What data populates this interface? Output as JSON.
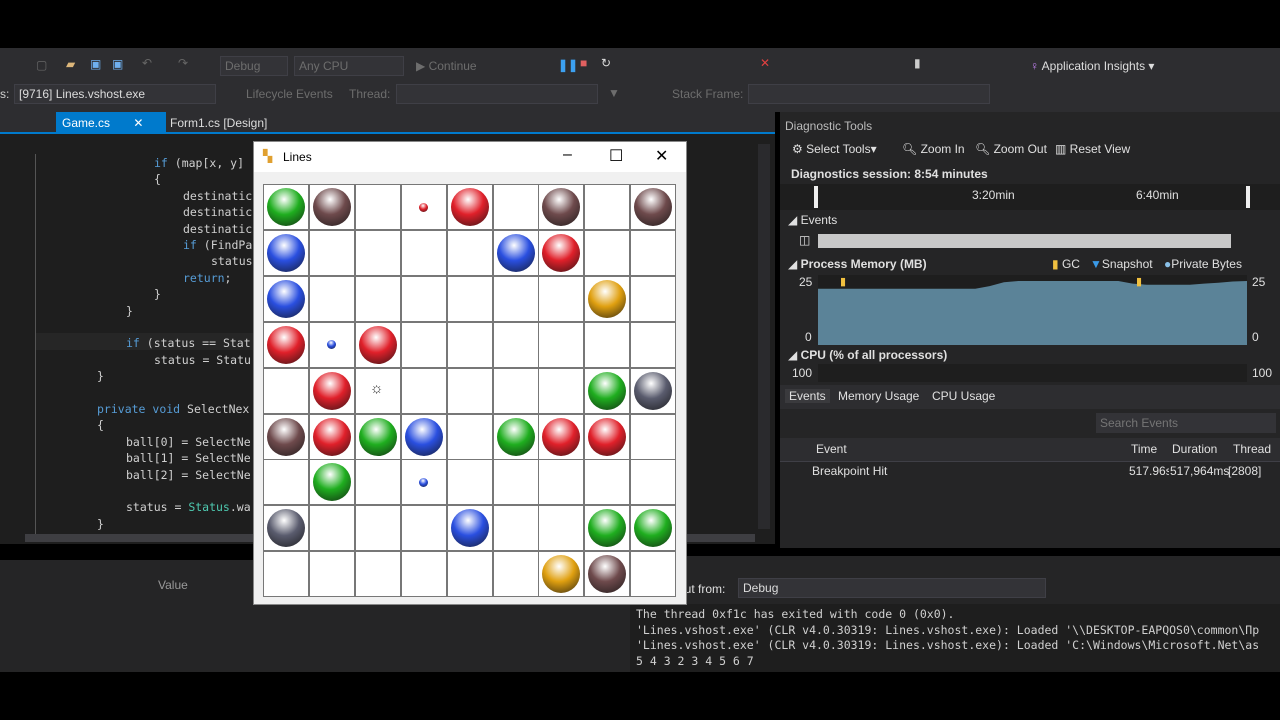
{
  "toolbar": {
    "config": "Debug",
    "platform": "Any CPU",
    "continue": "Continue",
    "app_insights": "Application Insights"
  },
  "debugbar": {
    "process_label": "s:",
    "process": "[9716] Lines.vshost.exe",
    "lifecycle": "Lifecycle Events",
    "thread_label": "Thread:",
    "stack_frame": "Stack Frame:"
  },
  "tabs": [
    {
      "label": "Game.cs",
      "active": true
    },
    {
      "label": "Form1.cs [Design]",
      "active": false
    }
  ],
  "code": [
    {
      "t": "if (map[x, y]",
      "i": 154
    },
    {
      "t": "{",
      "i": 154
    },
    {
      "t": "destinatic",
      "i": 183
    },
    {
      "t": "destinatic",
      "i": 183
    },
    {
      "t": "destinatic",
      "i": 183
    },
    {
      "t": "if (FindPa",
      "i": 183
    },
    {
      "t": "status",
      "i": 211
    },
    {
      "t": "return;",
      "i": 183
    },
    {
      "t": "}",
      "i": 154
    },
    {
      "t": "}",
      "i": 126
    },
    {
      "t": "",
      "i": 0
    },
    {
      "t": "if (status == Stat",
      "i": 126
    },
    {
      "t": "status = Statu",
      "i": 154
    },
    {
      "t": "}",
      "i": 97
    },
    {
      "t": "",
      "i": 0
    },
    {
      "t": "private void SelectNex",
      "i": 97
    },
    {
      "t": "{",
      "i": 97
    },
    {
      "t": "ball[0] = SelectNe",
      "i": 126
    },
    {
      "t": "ball[1] = SelectNe",
      "i": 126
    },
    {
      "t": "ball[2] = SelectNe",
      "i": 126
    },
    {
      "t": "",
      "i": 0
    },
    {
      "t": "status = Status.wa",
      "i": 126
    },
    {
      "t": "}",
      "i": 97
    }
  ],
  "watch": {
    "value_header": "Value"
  },
  "game": {
    "title": "Lines",
    "board": [
      "GM.rR.M.M",
      "B....BR..",
      "B......Y.",
      "RbR......",
      ".R*....GS",
      "MRGB.GRR.",
      ".G.b.....",
      "S...B..GG",
      "......YM."
    ],
    "colors": {
      "G": "#1fae1f",
      "B": "#2a4fe0",
      "R": "#e0202a",
      "M": "#6e4a4c",
      "Y": "#e0a010",
      "S": "#5a5c6e"
    }
  },
  "diag": {
    "title": "Diagnostic Tools",
    "select_tools": "Select Tools",
    "zoom_in": "Zoom In",
    "zoom_out": "Zoom Out",
    "reset_view": "Reset View",
    "session": "Diagnostics session: 8:54 minutes",
    "ticks": [
      "3:20min",
      "6:40min"
    ],
    "events_label": "Events",
    "memory_label": "Process Memory (MB)",
    "gc": "GC",
    "snapshot": "Snapshot",
    "private_bytes": "Private Bytes",
    "mem_max": "25",
    "mem_min": "0",
    "cpu_label": "CPU (% of all processors)",
    "cpu_max": "100",
    "memory_series": [
      22,
      22,
      22,
      22,
      22,
      22,
      22,
      22,
      22,
      22,
      22,
      22,
      23,
      24.5,
      25,
      25,
      25,
      25,
      25,
      25,
      25,
      25,
      24,
      23.5,
      23.5,
      23.5,
      23.5,
      24,
      24.3,
      24.8,
      25
    ],
    "tabs": [
      "Events",
      "Memory Usage",
      "CPU Usage"
    ],
    "search_placeholder": "Search Events",
    "columns": [
      "Event",
      "Time",
      "Duration",
      "Thread"
    ],
    "rows": [
      {
        "event": "Breakpoint Hit",
        "time": "517.96s",
        "duration": "517,964ms",
        "thread": "[2808]"
      }
    ]
  },
  "output": {
    "show_from_label": "out from:",
    "source": "Debug",
    "lines": [
      "The thread 0xf1c has exited with code 0 (0x0).",
      "'Lines.vshost.exe' (CLR v4.0.30319: Lines.vshost.exe): Loaded '\\\\DESKTOP-EAPQOS0\\common\\Пр",
      "'Lines.vshost.exe' (CLR v4.0.30319: Lines.vshost.exe): Loaded 'C:\\Windows\\Microsoft.Net\\as",
      "5 4 3 2 3 4 5 6 7"
    ]
  }
}
